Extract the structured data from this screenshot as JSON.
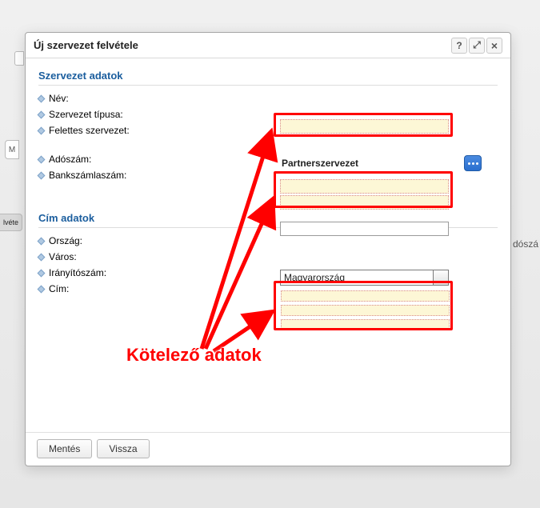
{
  "dialog": {
    "title": "Új szervezet felvétele"
  },
  "sections": {
    "org": "Szervezet adatok",
    "addr": "Cím adatok"
  },
  "labels": {
    "name": "Név:",
    "type": "Szervezet típusa:",
    "superior": "Felettes szervezet:",
    "tax": "Adószám:",
    "bank": "Bankszámlaszám:",
    "country": "Ország:",
    "city": "Város:",
    "zip": "Irányítószám:",
    "address": "Cím:"
  },
  "values": {
    "superior": "Partnerszervezet",
    "country": "Magyarország",
    "name": "",
    "tax": "",
    "bank": "",
    "bank2": "",
    "city": "",
    "zip": "",
    "address": ""
  },
  "buttons": {
    "save": "Mentés",
    "back": "Vissza"
  },
  "annotation": "Kötelező adatok",
  "titlebar": {
    "help": "?",
    "expand": "⤢",
    "close": "×"
  },
  "background": {
    "sidebar_tab": "lvéte",
    "m": "M",
    "right_label": "dószá"
  }
}
